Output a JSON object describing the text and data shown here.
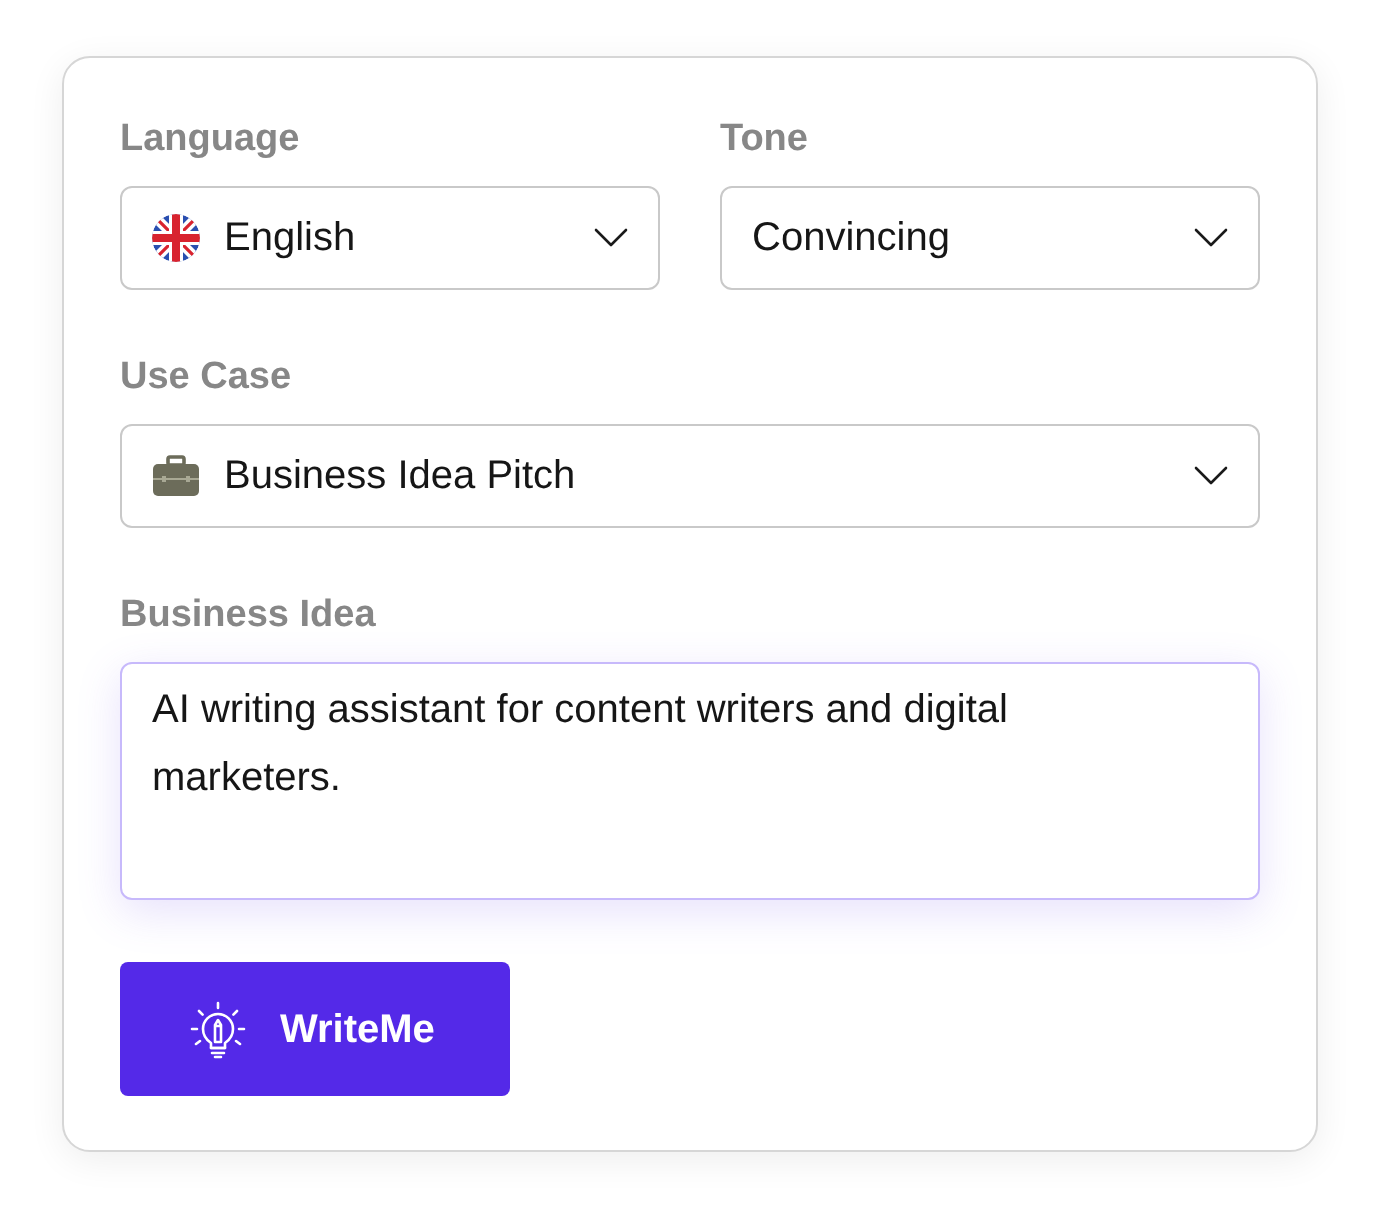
{
  "language": {
    "label": "Language",
    "value": "English"
  },
  "tone": {
    "label": "Tone",
    "value": "Convincing"
  },
  "use_case": {
    "label": "Use Case",
    "value": "Business Idea Pitch"
  },
  "business_idea": {
    "label": "Business Idea",
    "value": "AI writing assistant for content writers and digital marketers.",
    "focused": true
  },
  "submit_button": {
    "label": "WriteMe"
  }
}
